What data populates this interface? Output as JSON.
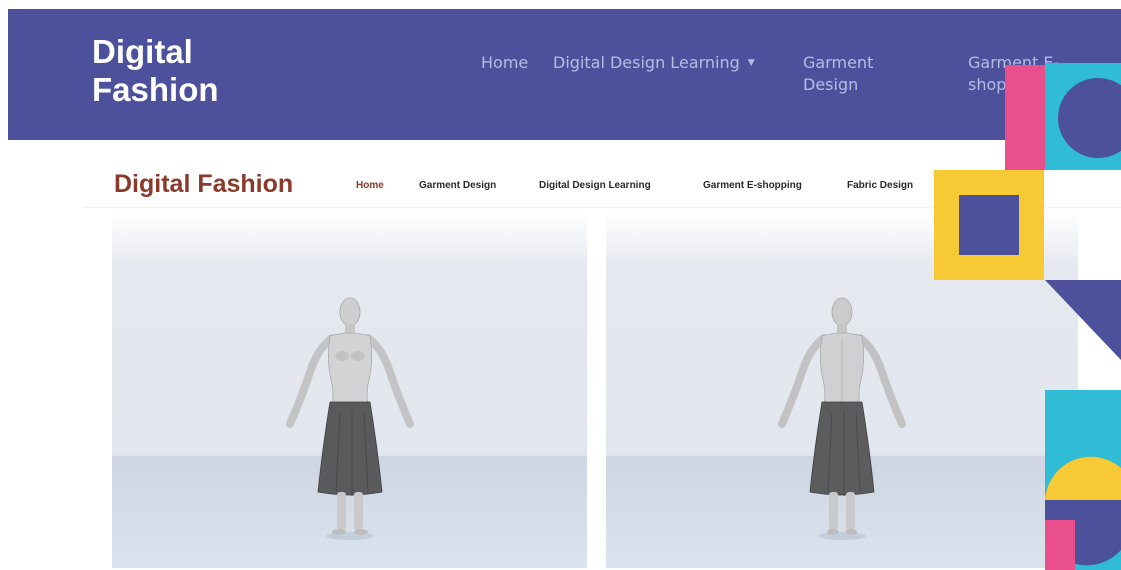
{
  "navbar": {
    "brand_line1": "Digital",
    "brand_line2": "Fashion",
    "home": "Home",
    "digital_design_learning": "Digital Design Learning",
    "garment_design": "Garment Design",
    "garment_eshop": "Garment E-shop"
  },
  "inner_site": {
    "brand": "Digital Fashion",
    "links": [
      {
        "label": "Home",
        "active": true
      },
      {
        "label": "Garment Design",
        "active": false
      },
      {
        "label": "Digital Design Learning",
        "active": false
      },
      {
        "label": "Garment E-shopping",
        "active": false
      },
      {
        "label": "Fabric Design",
        "active": false
      }
    ]
  },
  "views": [
    {
      "name": "front-view"
    },
    {
      "name": "back-view"
    }
  ],
  "colors": {
    "navbar_bg": "#4d519c",
    "accent_pink": "#e84f8c",
    "accent_cyan": "#2fbcd4",
    "accent_yellow": "#f7c934",
    "accent_indigo": "#4d519c",
    "inner_brand": "#8a3a2a"
  },
  "icons": {
    "caret": "caret-down-icon"
  }
}
